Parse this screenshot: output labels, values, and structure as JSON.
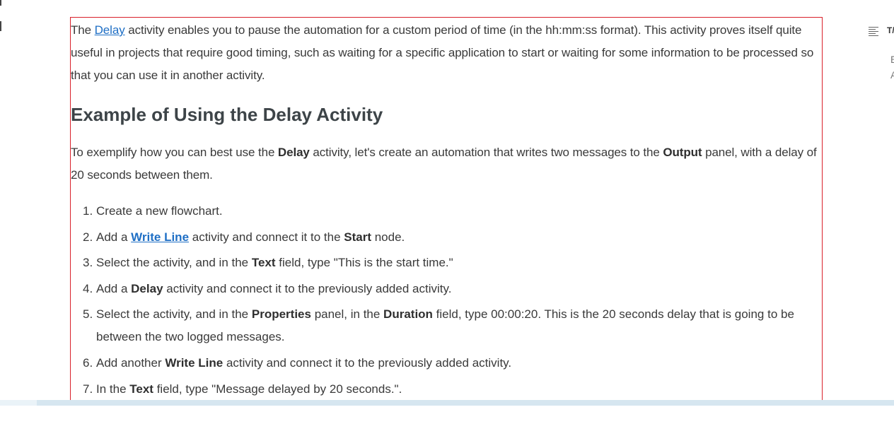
{
  "article": {
    "intro": {
      "before": "The ",
      "link": "Delay",
      "after": " activity enables you to pause the automation for a custom period of time (in the hh:mm:ss format). This activity proves itself quite useful in projects that require good timing, such as waiting for a specific application to start or waiting for some information to be processed so that you can use it in another activity."
    },
    "heading": "Example of Using the Delay Activity",
    "example": {
      "t1": "To exemplify how you can best use the ",
      "b1": "Delay",
      "t2": " activity, let's create an automation that writes two messages to the ",
      "b2": "Output",
      "t3": " panel, with a delay of 20 seconds between them."
    },
    "steps": [
      {
        "num": "1.",
        "t1": "Create a new flowchart."
      },
      {
        "num": "2.",
        "t1": "Add a ",
        "link": "Write Line",
        "t2": " activity and connect it to the ",
        "b1": "Start",
        "t3": " node."
      },
      {
        "num": "3.",
        "t1": "Select the activity, and in the ",
        "b1": "Text",
        "t2": " field, type \"This is the start time.\""
      },
      {
        "num": "4.",
        "t1": "Add a ",
        "b1": "Delay",
        "t2": " activity and connect it to the previously added activity."
      },
      {
        "num": "5.",
        "t1": "Select the activity, and in the ",
        "b1": "Properties",
        "t2": " panel, in the ",
        "b2": "Duration",
        "t3": " field, type 00:00:20. This is the 20 seconds delay that is going to be between the two logged messages."
      },
      {
        "num": "6.",
        "t1": "Add another ",
        "b1": "Write Line",
        "t2": " activity and connect it to the previously added activity."
      },
      {
        "num": "7.",
        "t1": "In the ",
        "b1": "Text",
        "t2": " field, type \"Message delayed by 20 seconds.\"."
      }
    ]
  },
  "toc": {
    "icon": "list-icon",
    "title": "T/",
    "line1": "E",
    "line2": "A"
  },
  "colors": {
    "highlight_border": "#d9202a",
    "link": "#1f6fc5"
  }
}
